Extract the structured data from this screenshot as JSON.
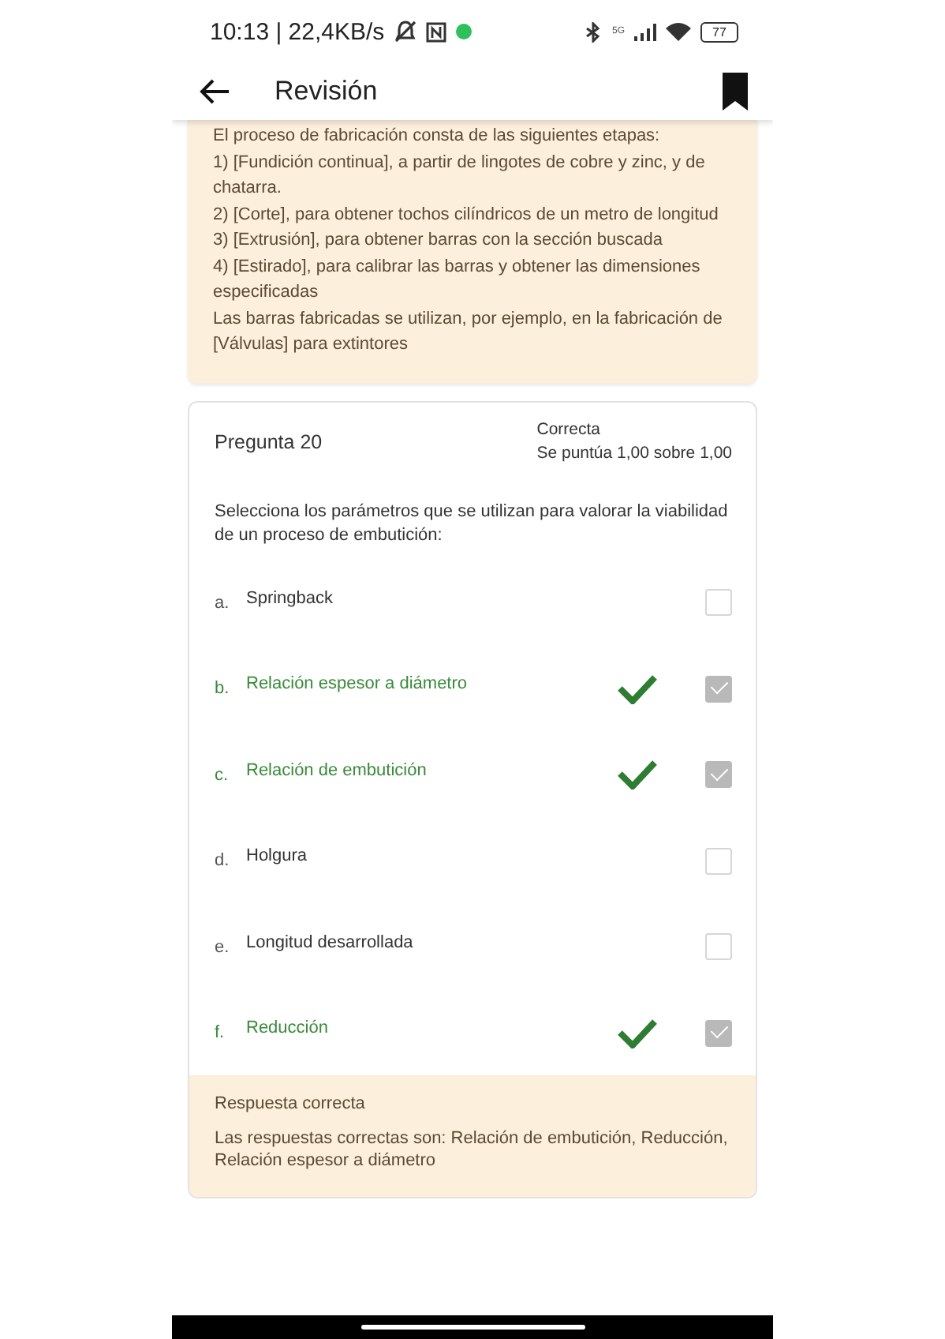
{
  "status_bar": {
    "time": "10:13 | 22,4KB/s",
    "network_label": "5G",
    "battery": "77"
  },
  "header": {
    "title": "Revisión"
  },
  "feedback": {
    "lines": [
      "El proceso de fabricación consta de las siguientes etapas:",
      "1) [Fundición continua], a partir de  lingotes de cobre y zinc, y de chatarra.",
      "2) [Corte], para obtener tochos cilíndricos de un metro de longitud",
      "3) [Extrusión], para obtener barras con la sección buscada",
      "4) [Estirado], para calibrar las barras y obtener las dimensiones especificadas",
      "Las barras fabricadas se utilizan, por ejemplo, en la fabricación de [Válvulas] para extintores"
    ]
  },
  "question": {
    "title": "Pregunta 20",
    "state": "Correcta",
    "grade": "Se puntúa 1,00 sobre 1,00",
    "text": "Selecciona los parámetros que se utilizan para valorar la viabilidad de un proceso de embutición:",
    "options": [
      {
        "letter": "a.",
        "text": "Springback",
        "checked": false,
        "correct": false
      },
      {
        "letter": "b.",
        "text": "Relación espesor a diámetro",
        "checked": true,
        "correct": true
      },
      {
        "letter": "c.",
        "text": "Relación de embutición",
        "checked": true,
        "correct": true
      },
      {
        "letter": "d.",
        "text": "Holgura",
        "checked": false,
        "correct": false
      },
      {
        "letter": "e.",
        "text": "Longitud desarrollada",
        "checked": false,
        "correct": false
      },
      {
        "letter": "f.",
        "text": "Reducción",
        "checked": true,
        "correct": true
      }
    ],
    "answer": {
      "title": "Respuesta correcta",
      "text": "Las respuestas correctas son: Relación de embutición, Reducción, Relación espesor a diámetro"
    }
  }
}
